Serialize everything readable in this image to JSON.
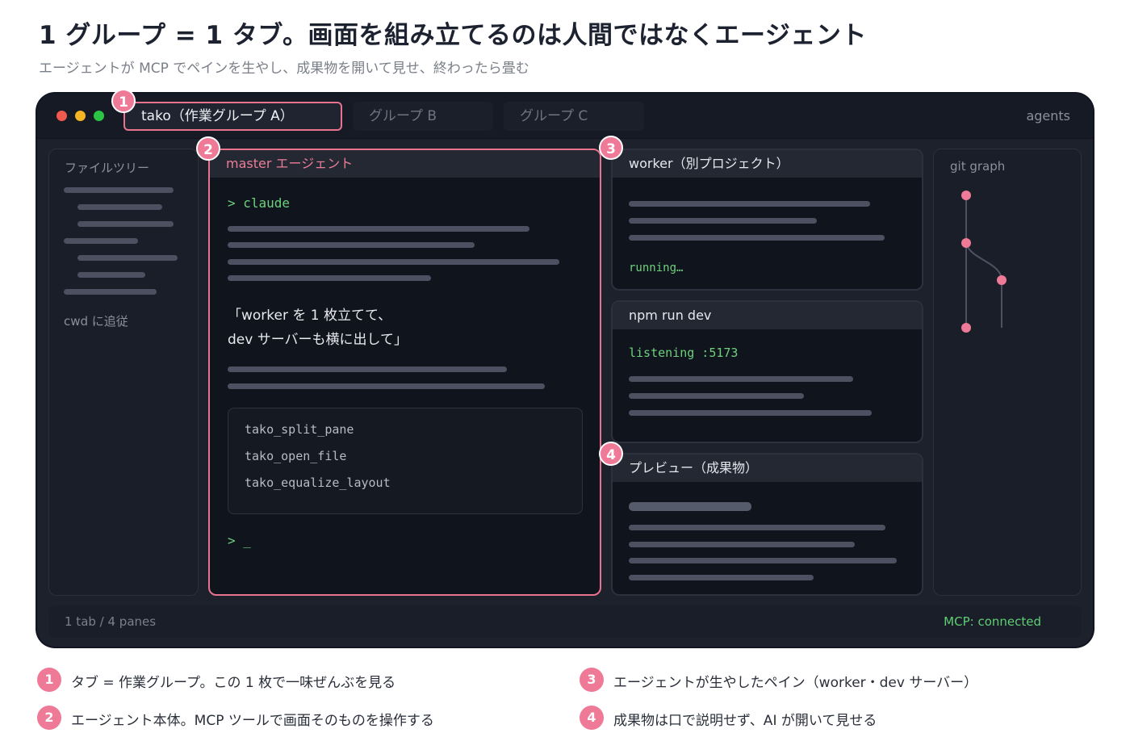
{
  "header": {
    "title": "1 グループ = 1 タブ。画面を組み立てるのは人間ではなくエージェント",
    "subtitle": "エージェントが MCP でペインを生やし、成果物を開いて見せ、終わったら畳む"
  },
  "window": {
    "tabs": [
      {
        "label": "tako（作業グループ A）",
        "badge": "1"
      },
      {
        "label": "グループ B"
      },
      {
        "label": "グループ C"
      }
    ],
    "agents_label": "agents"
  },
  "filetree": {
    "label": "ファイルツリー",
    "cwd_label": "cwd に追従"
  },
  "master": {
    "badge": "2",
    "title": "master エージェント",
    "prompt": "> claude",
    "message_line1": "「worker を 1 枚立てて、",
    "message_line2": "dev サーバーも横に出して」",
    "tools": [
      "tako_split_pane",
      "tako_open_file",
      "tako_equalize_layout"
    ],
    "cursor_prompt": "> _"
  },
  "worker": {
    "badge": "3",
    "title": "worker（別プロジェクト）",
    "status": "running…"
  },
  "npm": {
    "title": "npm run dev",
    "status": "listening :5173"
  },
  "preview": {
    "badge": "4",
    "title": "プレビュー（成果物）"
  },
  "gitgraph": {
    "label": "git graph"
  },
  "statusbar": {
    "left": "1 tab / 4 panes",
    "right": "MCP: connected"
  },
  "legend": [
    {
      "num": "1",
      "text": "タブ = 作業グループ。この 1 枚で一味ぜんぶを見る"
    },
    {
      "num": "2",
      "text": "エージェント本体。MCP ツールで画面そのものを操作する"
    },
    {
      "num": "3",
      "text": "エージェントが生やしたペイン（worker・dev サーバー）"
    },
    {
      "num": "4",
      "text": "成果物は口で説明せず、AI が開いて見せる"
    }
  ],
  "colors": {
    "accent": "#ee7a97",
    "window_bg": "#1c212c",
    "terminal_green": "#6ed17e"
  }
}
